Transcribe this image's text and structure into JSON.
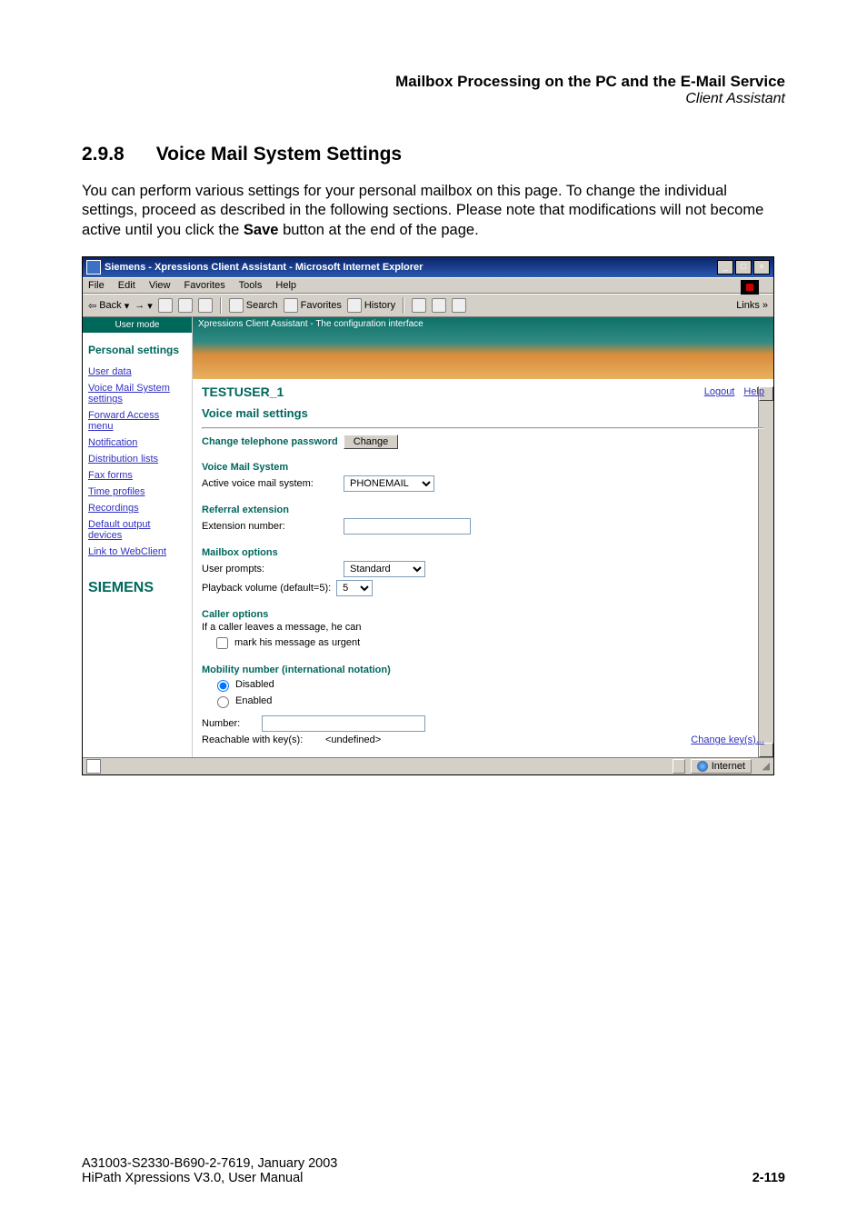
{
  "doc": {
    "chapter_title": "Mailbox Processing on the PC and the E-Mail Service",
    "subsection": "Client Assistant",
    "section_number": "2.9.8",
    "section_title": "Voice Mail System Settings",
    "body_pre": "You can perform various settings for your personal mailbox on this page. To change the individual settings, proceed as described in the following sections. Please note that modifications will not become active until you click the ",
    "body_strong": "Save",
    "body_post": " button at the end of the page.",
    "footer_line1": "A31003-S2330-B690-2-7619, January 2003",
    "footer_line2": "HiPath Xpressions V3.0, User Manual",
    "page_number": "2-119"
  },
  "ie": {
    "title": "Siemens - Xpressions Client Assistant - Microsoft Internet Explorer",
    "window_controls": {
      "min": "_",
      "max": "□",
      "close": "×"
    },
    "menubar": [
      "File",
      "Edit",
      "View",
      "Favorites",
      "Tools",
      "Help"
    ],
    "toolbar": {
      "back": "Back",
      "search": "Search",
      "favorites": "Favorites",
      "history": "History",
      "links": "Links"
    },
    "status": {
      "zone": "Internet"
    }
  },
  "sidebar": {
    "tab": "User mode",
    "heading": "Personal settings",
    "items": [
      "User data",
      "Voice Mail System settings",
      "Forward Access menu",
      "Notification",
      "Distribution lists",
      "Fax forms",
      "Time profiles",
      "Recordings",
      "Default output devices",
      "Link to WebClient"
    ],
    "brand": "SIEMENS"
  },
  "main": {
    "banner_caption": "Xpressions Client Assistant - The configuration interface",
    "username": "TESTUSER_1",
    "links": {
      "logout": "Logout",
      "help": "Help"
    },
    "title": "Voice mail settings",
    "change_pw_label": "Change telephone password",
    "change_btn": "Change",
    "vms_heading": "Voice Mail System",
    "vms_active_label": "Active voice mail system:",
    "vms_active_value": "PHONEMAIL",
    "referral_heading": "Referral extension",
    "referral_label": "Extension number:",
    "referral_value": "",
    "mbox_heading": "Mailbox options",
    "userprompts_label": "User prompts:",
    "userprompts_value": "Standard",
    "playback_label": "Playback volume (default=5):",
    "playback_value": "5",
    "caller_heading": "Caller options",
    "caller_line1": "If a caller leaves a message, he can",
    "caller_check1": "mark his message as urgent",
    "mobility_heading": "Mobility number (international notation)",
    "mobility_disabled": "Disabled",
    "mobility_enabled": "Enabled",
    "mobility_number_label": "Number:",
    "mobility_number_value": "",
    "reachable_label": "Reachable with key(s):",
    "reachable_value": "<undefined>",
    "change_keys": "Change key(s)..."
  }
}
